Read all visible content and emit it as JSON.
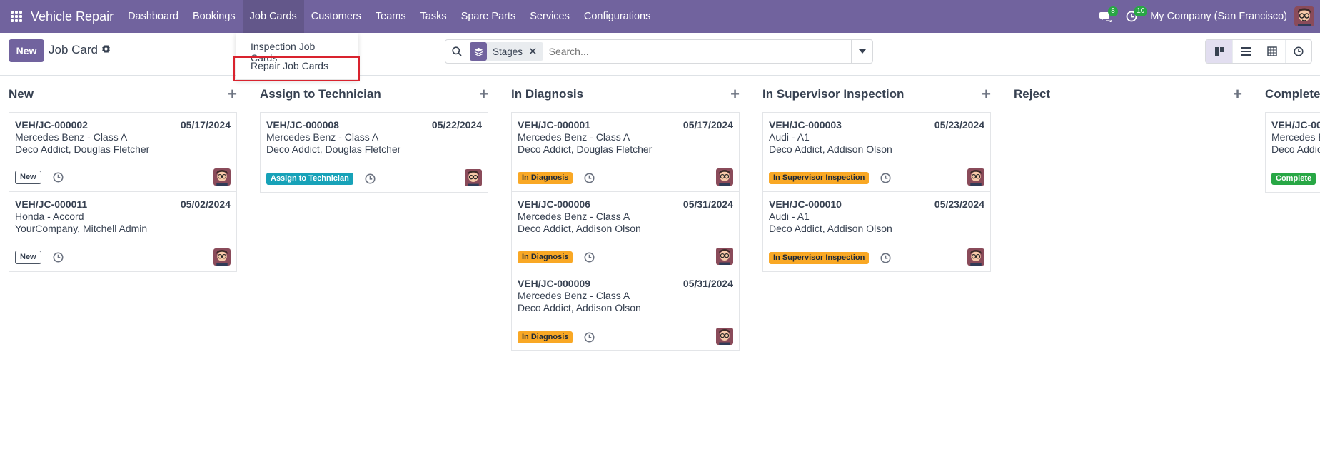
{
  "navbar": {
    "app_name": "Vehicle Repair",
    "menu": [
      "Dashboard",
      "Bookings",
      "Job Cards",
      "Customers",
      "Teams",
      "Tasks",
      "Spare Parts",
      "Services",
      "Configurations"
    ],
    "messages_count": "8",
    "activities_count": "10",
    "company": "My Company (San Francisco)"
  },
  "control": {
    "new_label": "New",
    "title": "Job Card",
    "facet_label": "Stages",
    "search_placeholder": "Search..."
  },
  "dropdown": {
    "items": [
      "Inspection Job Cards",
      "Repair Job Cards"
    ]
  },
  "colors": {
    "brand": "#71639e",
    "tag_teal": "#17a2b8",
    "tag_orange": "#f9a825",
    "tag_green": "#28a745",
    "highlight": "#d9232e"
  },
  "columns": [
    {
      "title": "New",
      "cards": [
        {
          "ref": "VEH/JC-000002",
          "date": "05/17/2024",
          "vehicle": "Mercedes Benz - Class A",
          "people": "Deco Addict, Douglas Fletcher",
          "tag": "New"
        },
        {
          "ref": "VEH/JC-000011",
          "date": "05/02/2024",
          "vehicle": "Honda - Accord",
          "people": "YourCompany, Mitchell Admin",
          "tag": "New"
        }
      ]
    },
    {
      "title": "Assign to Technician",
      "cards": [
        {
          "ref": "VEH/JC-000008",
          "date": "05/22/2024",
          "vehicle": "Mercedes Benz - Class A",
          "people": "Deco Addict, Douglas Fletcher",
          "tag": "Assign to Technician"
        }
      ]
    },
    {
      "title": "In Diagnosis",
      "cards": [
        {
          "ref": "VEH/JC-000001",
          "date": "05/17/2024",
          "vehicle": "Mercedes Benz - Class A",
          "people": "Deco Addict, Douglas Fletcher",
          "tag": "In Diagnosis"
        },
        {
          "ref": "VEH/JC-000006",
          "date": "05/31/2024",
          "vehicle": "Mercedes Benz - Class A",
          "people": "Deco Addict, Addison Olson",
          "tag": "In Diagnosis"
        },
        {
          "ref": "VEH/JC-000009",
          "date": "05/31/2024",
          "vehicle": "Mercedes Benz - Class A",
          "people": "Deco Addict, Addison Olson",
          "tag": "In Diagnosis"
        }
      ]
    },
    {
      "title": "In Supervisor Inspection",
      "cards": [
        {
          "ref": "VEH/JC-000003",
          "date": "05/23/2024",
          "vehicle": "Audi - A1",
          "people": "Deco Addict, Addison Olson",
          "tag": "In Supervisor Inspection"
        },
        {
          "ref": "VEH/JC-000010",
          "date": "05/23/2024",
          "vehicle": "Audi - A1",
          "people": "Deco Addict, Addison Olson",
          "tag": "In Supervisor Inspection"
        }
      ]
    },
    {
      "title": "Reject",
      "cards": []
    },
    {
      "title": "Complete",
      "cards": [
        {
          "ref": "VEH/JC-00",
          "date": "",
          "vehicle": "Mercedes B",
          "people": "Deco Addic",
          "tag": "Complete"
        }
      ]
    }
  ]
}
